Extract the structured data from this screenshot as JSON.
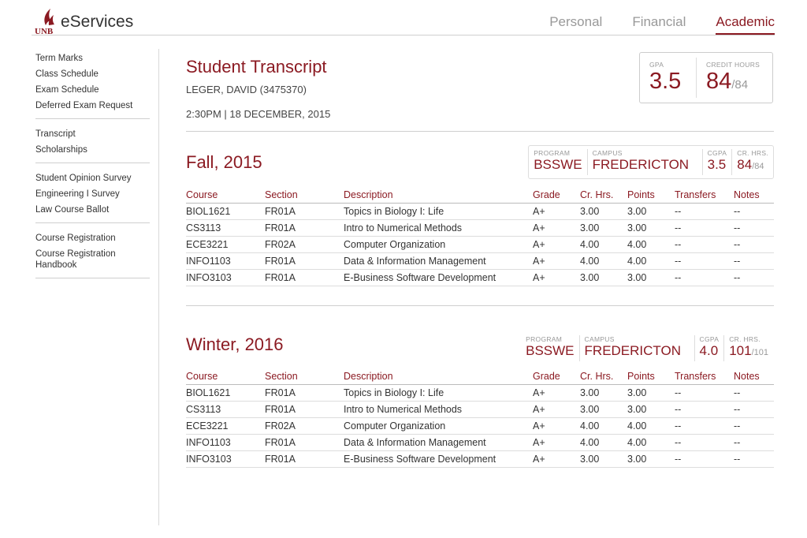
{
  "app": {
    "logo_text": "UNB",
    "title": "eServices"
  },
  "nav": {
    "tabs": [
      {
        "label": "Personal"
      },
      {
        "label": "Financial"
      },
      {
        "label": "Academic"
      }
    ]
  },
  "sidebar": {
    "groups": [
      [
        "Term Marks",
        "Class Schedule",
        "Exam Schedule",
        "Deferred Exam Request"
      ],
      [
        "Transcript",
        "Scholarships"
      ],
      [
        "Student Opinion Survey",
        "Engineering I Survey",
        "Law Course Ballot"
      ],
      [
        "Course Registration",
        "Course Registration Handbook"
      ]
    ]
  },
  "transcript": {
    "title": "Student Transcript",
    "student": "LEGER, DAVID (3475370)",
    "timestamp": "2:30PM | 18 DECEMBER, 2015",
    "gpa_label": "GPA",
    "gpa": "3.5",
    "credit_label": "CREDIT HOURS",
    "credit_hours": "84",
    "credit_total": "/84"
  },
  "columns": [
    "Course",
    "Section",
    "Description",
    "Grade",
    "Cr. Hrs.",
    "Points",
    "Transfers",
    "Notes"
  ],
  "terms": [
    {
      "title": "Fall, 2015",
      "program_label": "PROGRAM",
      "program": "BSSWE",
      "campus_label": "CAMPUS",
      "campus": "FREDERICTON",
      "cgpa_label": "CGPA",
      "cgpa": "3.5",
      "crhrs_label": "CR. HRS.",
      "crhrs": "84",
      "crhrs_total": "/84",
      "rows": [
        [
          "BIOL1621",
          "FR01A",
          "Topics in Biology I: Life",
          "A+",
          "3.00",
          "3.00",
          "--",
          "--"
        ],
        [
          "CS3113",
          "FR01A",
          "Intro to Numerical Methods",
          "A+",
          "3.00",
          "3.00",
          "--",
          "--"
        ],
        [
          "ECE3221",
          "FR02A",
          "Computer Organization",
          "A+",
          "4.00",
          "4.00",
          "--",
          "--"
        ],
        [
          "INFO1103",
          "FR01A",
          "Data & Information Management",
          "A+",
          "4.00",
          "4.00",
          "--",
          "--"
        ],
        [
          "INFO3103",
          "FR01A",
          "E-Business Software Development",
          "A+",
          "3.00",
          "3.00",
          "--",
          "--"
        ]
      ]
    },
    {
      "title": "Winter, 2016",
      "program_label": "PROGRAM",
      "program": "BSSWE",
      "campus_label": "CAMPUS",
      "campus": "FREDERICTON",
      "cgpa_label": "CGPA",
      "cgpa": "4.0",
      "crhrs_label": "CR. HRS.",
      "crhrs": "101",
      "crhrs_total": "/101",
      "rows": [
        [
          "BIOL1621",
          "FR01A",
          "Topics in Biology I: Life",
          "A+",
          "3.00",
          "3.00",
          "--",
          "--"
        ],
        [
          "CS3113",
          "FR01A",
          "Intro to Numerical Methods",
          "A+",
          "3.00",
          "3.00",
          "--",
          "--"
        ],
        [
          "ECE3221",
          "FR02A",
          "Computer Organization",
          "A+",
          "4.00",
          "4.00",
          "--",
          "--"
        ],
        [
          "INFO1103",
          "FR01A",
          "Data & Information Management",
          "A+",
          "4.00",
          "4.00",
          "--",
          "--"
        ],
        [
          "INFO3103",
          "FR01A",
          "E-Business Software Development",
          "A+",
          "3.00",
          "3.00",
          "--",
          "--"
        ]
      ]
    }
  ],
  "colors": {
    "accent": "#8b1a22",
    "muted": "#999999",
    "rule": "#cfcfcf"
  }
}
